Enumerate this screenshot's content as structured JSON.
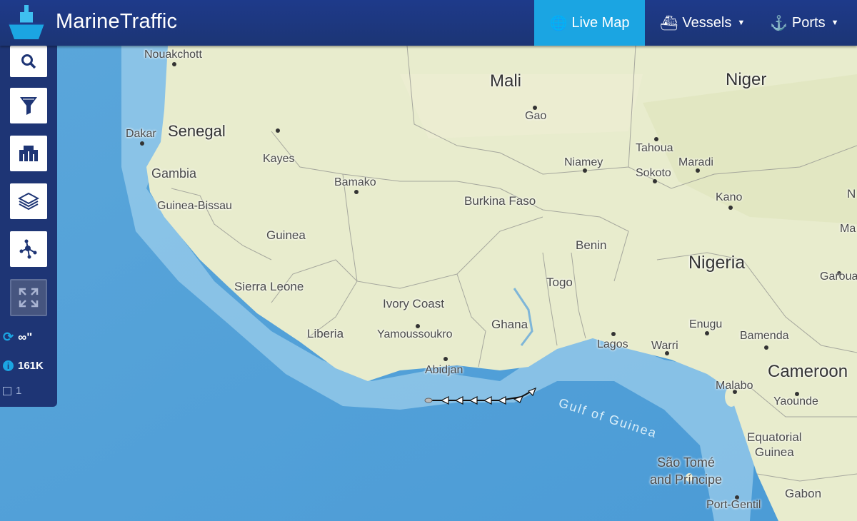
{
  "header": {
    "brand": "MarineTraffic",
    "nav": {
      "live_map": "Live Map",
      "vessels": "Vessels",
      "ports": "Ports"
    }
  },
  "sidebar": {
    "tools": [
      "search-icon",
      "filter-icon",
      "gift-icon",
      "layers-icon",
      "network-icon",
      "fullscreen-icon"
    ],
    "refresh_label": "∞\"",
    "vessel_count": "161K",
    "selected_count": "1"
  },
  "map": {
    "countries": {
      "mali": "Mali",
      "niger": "Niger",
      "senegal": "Senegal",
      "gambia": "Gambia",
      "guinea_bissau": "Guinea-Bissau",
      "guinea": "Guinea",
      "sierra_leone": "Sierra Leone",
      "liberia": "Liberia",
      "ivory_coast": "Ivory Coast",
      "ghana": "Ghana",
      "togo": "Togo",
      "benin": "Benin",
      "burkina_faso": "Burkina Faso",
      "nigeria": "Nigeria",
      "cameroon": "Cameroon",
      "equatorial_guinea": "Equatorial\nGuinea",
      "sao_tome": "São Tomé\nand Príncipe",
      "gabon": "Gabon"
    },
    "cities": {
      "nouakchott": "Nouakchott",
      "dakar": "Dakar",
      "kayes": "Kayes",
      "bamako": "Bamako",
      "gao": "Gao",
      "niamey": "Niamey",
      "tahoua": "Tahoua",
      "maradi": "Maradi",
      "sokoto": "Sokoto",
      "kano": "Kano",
      "yamoussoukro": "Yamoussoukro",
      "abidjan": "Abidjan",
      "lagos": "Lagos",
      "warri": "Warri",
      "enugu": "Enugu",
      "bamenda": "Bamenda",
      "malabo": "Malabo",
      "yaounde": "Yaounde",
      "port_gentil": "Port-Gentil",
      "garoua": "Garoua"
    },
    "sea": "Gulf of Guinea",
    "edge": {
      "n": "N",
      "ma": "Ma"
    }
  },
  "colors": {
    "header": "#1e3a8a",
    "accent": "#1ba5e2",
    "ocean": "#6fb3de",
    "land": "#e8eccd"
  }
}
